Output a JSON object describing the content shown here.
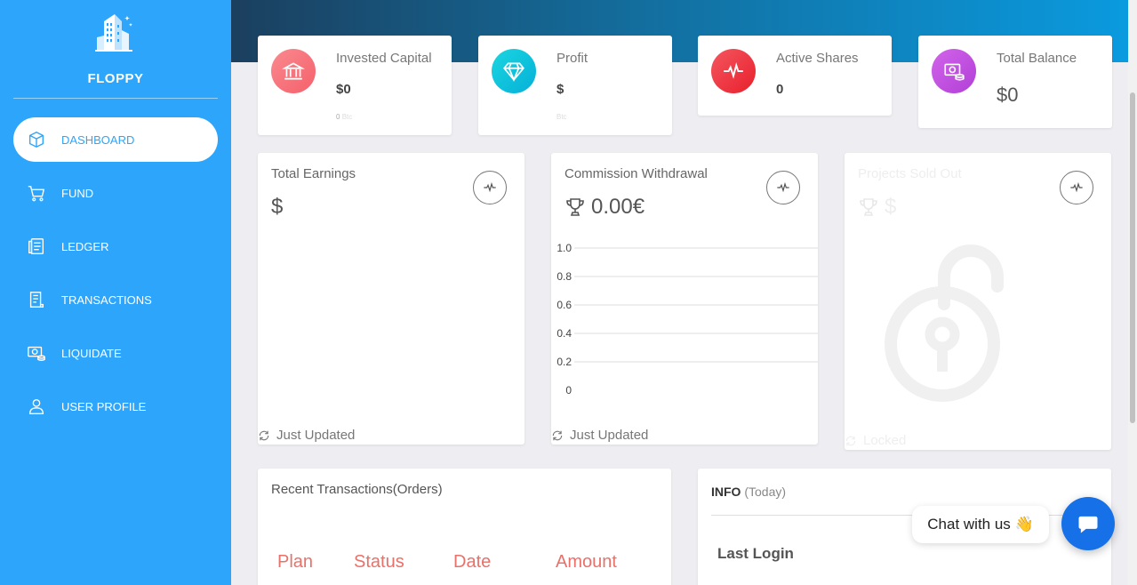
{
  "brand": {
    "name": "FLOPPY"
  },
  "nav": [
    {
      "label": "DASHBOARD",
      "icon": "box-icon",
      "active": true
    },
    {
      "label": "FUND",
      "icon": "cart-icon"
    },
    {
      "label": "LEDGER",
      "icon": "ledger-icon"
    },
    {
      "label": "TRANSACTIONS",
      "icon": "receipt-icon"
    },
    {
      "label": "LIQUIDATE",
      "icon": "cash-icon"
    },
    {
      "label": "USER PROFILE",
      "icon": "user-icon"
    }
  ],
  "stats": [
    {
      "title": "Invested Capital",
      "value": "$0",
      "sub_value": "0",
      "sub_unit": "Btc",
      "color": "#fb6b71",
      "icon": "bank-icon"
    },
    {
      "title": "Profit",
      "value": "$",
      "sub_unit": "Btc",
      "color": "#0bc3d9",
      "icon": "diamond-icon"
    },
    {
      "title": "Active Shares",
      "value": "0",
      "color": "#f0343c",
      "icon": "pulse-icon"
    },
    {
      "title": "Total Balance",
      "value": "$0",
      "color": "#c54de0",
      "icon": "money-icon"
    }
  ],
  "cards": {
    "earnings": {
      "title": "Total Earnings",
      "value": "$",
      "footer": "Just Updated"
    },
    "commission": {
      "title": "Commission Withdrawal",
      "value": "0.00€",
      "footer": "Just Updated"
    },
    "projects": {
      "title": "Projects Sold Out",
      "value": "$",
      "footer": "Locked"
    }
  },
  "chart_data": {
    "type": "line",
    "x": [],
    "series": [],
    "yticks": [
      "1.0",
      "0.8",
      "0.6",
      "0.4",
      "0.2",
      "0"
    ],
    "ylim": [
      0,
      1
    ],
    "grid": true
  },
  "recent": {
    "title": "Recent Transactions(Orders)",
    "columns": [
      "Plan",
      "Status",
      "Date",
      "Amount"
    ]
  },
  "info": {
    "title": "INFO",
    "subtitle": "(Today)",
    "last_login_label": "Last Login"
  },
  "chat": {
    "label": "Chat with us",
    "emoji": "👋"
  },
  "colors": {
    "sidebar": "#2da5fb",
    "accent": "#e8716a",
    "chat": "#1670e8"
  }
}
